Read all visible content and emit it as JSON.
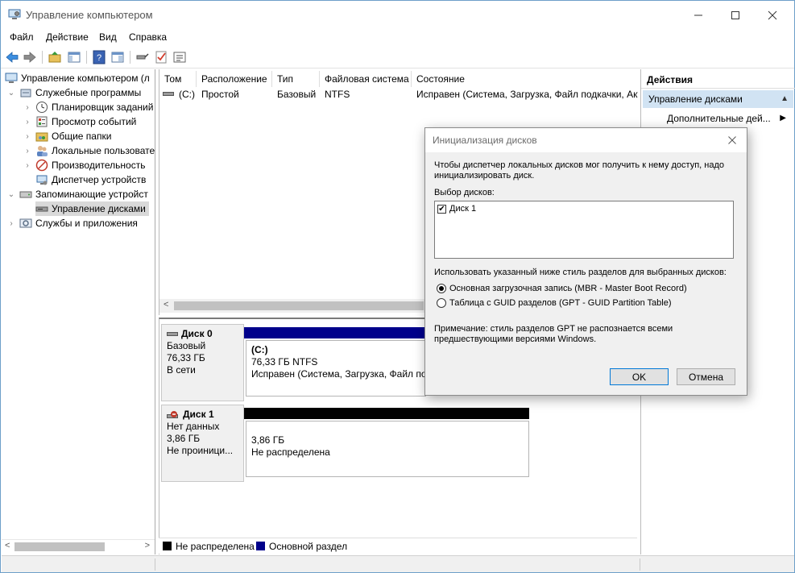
{
  "window": {
    "title": "Управление компьютером",
    "controls": [
      "minimize-icon",
      "maximize-icon",
      "close-icon"
    ]
  },
  "menu": [
    "Файл",
    "Действие",
    "Вид",
    "Справка"
  ],
  "tree": {
    "root": "Управление компьютером (л",
    "items": [
      {
        "label": "Служебные программы",
        "icon": "tools-icon"
      },
      {
        "label": "Планировщик заданий",
        "icon": "clock-icon"
      },
      {
        "label": "Просмотр событий",
        "icon": "event-viewer-icon"
      },
      {
        "label": "Общие папки",
        "icon": "shared-folder-icon"
      },
      {
        "label": "Локальные пользовате",
        "icon": "users-icon"
      },
      {
        "label": "Производительность",
        "icon": "performance-icon"
      },
      {
        "label": "Диспетчер устройств",
        "icon": "device-manager-icon"
      },
      {
        "label": "Запоминающие устройст",
        "icon": "storage-icon"
      },
      {
        "label": "Управление дисками",
        "icon": "disk-management-icon"
      },
      {
        "label": "Службы и приложения",
        "icon": "services-icon"
      }
    ]
  },
  "volumes": {
    "columns": [
      "Том",
      "Расположение",
      "Тип",
      "Файловая система",
      "Состояние"
    ],
    "rows": [
      {
        "tom": "(C:)",
        "location": "Простой",
        "type": "Базовый",
        "fs": "NTFS",
        "status": "Исправен (Система, Загрузка, Файл подкачки, Акт"
      }
    ]
  },
  "disks": [
    {
      "name": "Диск 0",
      "kind": "Базовый",
      "size": "76,33 ГБ",
      "state": "В сети",
      "partition": {
        "title": "(C:)",
        "size": "76,33 ГБ NTFS",
        "status": "Исправен (Система, Загрузка, Файл под"
      }
    },
    {
      "name": "Диск 1",
      "kind": "Нет данных",
      "size": "3,86 ГБ",
      "state": "Не проиници...",
      "partition": {
        "size": "3,86 ГБ",
        "status": "Не распределена"
      }
    }
  ],
  "legend": [
    {
      "label": "Не распределена",
      "color": "#000000"
    },
    {
      "label": "Основной раздел",
      "color": "#00008b"
    }
  ],
  "actions": {
    "header": "Действия",
    "section": "Управление дисками",
    "more": "Дополнительные дей..."
  },
  "dialog": {
    "title": "Инициализация дисков",
    "intro_line1": "Чтобы диспетчер локальных дисков мог получить к нему доступ, надо",
    "intro_line2": "инициализировать диск.",
    "select_label": "Выбор дисков:",
    "disk_item": "Диск 1",
    "disk_checked": true,
    "style_label": "Использовать указанный ниже стиль разделов для выбранных дисков:",
    "option_mbr": "Основная загрузочная запись (MBR - Master Boot Record)",
    "option_gpt": "Таблица с GUID разделов (GPT - GUID Partition Table)",
    "selected_option": "mbr",
    "note_line1": "Примечание: стиль разделов GPT не распознается всеми",
    "note_line2": "предшествующими версиями Windows.",
    "ok": "OK",
    "cancel": "Отмена"
  },
  "colors": {
    "primary_partition": "#00008b",
    "unallocated": "#000000",
    "selection": "#d1e3f3"
  }
}
